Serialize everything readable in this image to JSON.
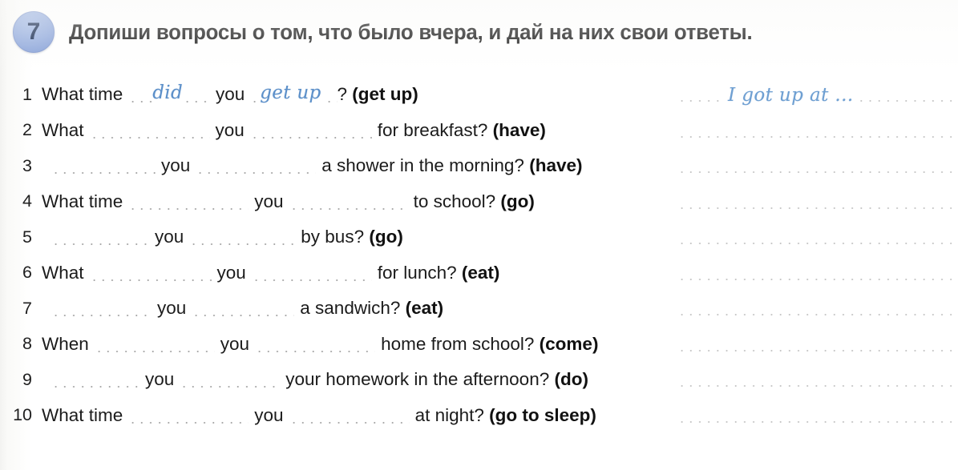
{
  "header": {
    "task_number": "7",
    "instruction": "Допиши вопросы о том, что было вчера, и дай на них свои ответы."
  },
  "exercises": [
    {
      "number": "1",
      "lead": "What time",
      "gap1_answer": "did",
      "you": "you",
      "gap2_answer": "get up",
      "tail": "? (get up)",
      "tail_plain": "?",
      "verb_hint": "(get up)",
      "answer_line": "I got up at ..."
    },
    {
      "number": "2",
      "lead": "What",
      "gap1_answer": "",
      "you": "you",
      "gap2_answer": "",
      "tail_plain": "for breakfast?",
      "verb_hint": "(have)",
      "answer_line": ""
    },
    {
      "number": "3",
      "lead": "",
      "gap1_answer": "",
      "you": "you",
      "gap2_answer": "",
      "tail_plain": "a shower in the morning?",
      "verb_hint": "(have)",
      "answer_line": ""
    },
    {
      "number": "4",
      "lead": "What time",
      "gap1_answer": "",
      "you": "you",
      "gap2_answer": "",
      "tail_plain": "to school?",
      "verb_hint": "(go)",
      "answer_line": ""
    },
    {
      "number": "5",
      "lead": "",
      "gap1_answer": "",
      "you": "you",
      "gap2_answer": "",
      "tail_plain": "by bus?",
      "verb_hint": "(go)",
      "answer_line": ""
    },
    {
      "number": "6",
      "lead": "What",
      "gap1_answer": "",
      "you": "you",
      "gap2_answer": "",
      "tail_plain": "for lunch?",
      "verb_hint": "(eat)",
      "answer_line": ""
    },
    {
      "number": "7",
      "lead": "",
      "gap1_answer": "",
      "you": "you",
      "gap2_answer": "",
      "tail_plain": "a sandwich?",
      "verb_hint": "(eat)",
      "answer_line": ""
    },
    {
      "number": "8",
      "lead": "When",
      "gap1_answer": "",
      "you": "you",
      "gap2_answer": "",
      "tail_plain": "home from school?",
      "verb_hint": "(come)",
      "answer_line": ""
    },
    {
      "number": "9",
      "lead": "",
      "gap1_answer": "",
      "you": "you",
      "gap2_answer": "",
      "tail_plain": "your homework in the afternoon?",
      "verb_hint": "(do)",
      "answer_line": ""
    },
    {
      "number": "10",
      "lead": "What time",
      "gap1_answer": "",
      "you": "you",
      "gap2_answer": "",
      "tail_plain": "at night?",
      "verb_hint": "(go to sleep)",
      "answer_line": ""
    }
  ],
  "colors": {
    "badge_fill": "#8fa8dc",
    "badge_text": "#10244b",
    "ink_blue": "#5b8fc9",
    "dot_gray": "#9a9a9a",
    "text_black": "#1b1b1b"
  }
}
